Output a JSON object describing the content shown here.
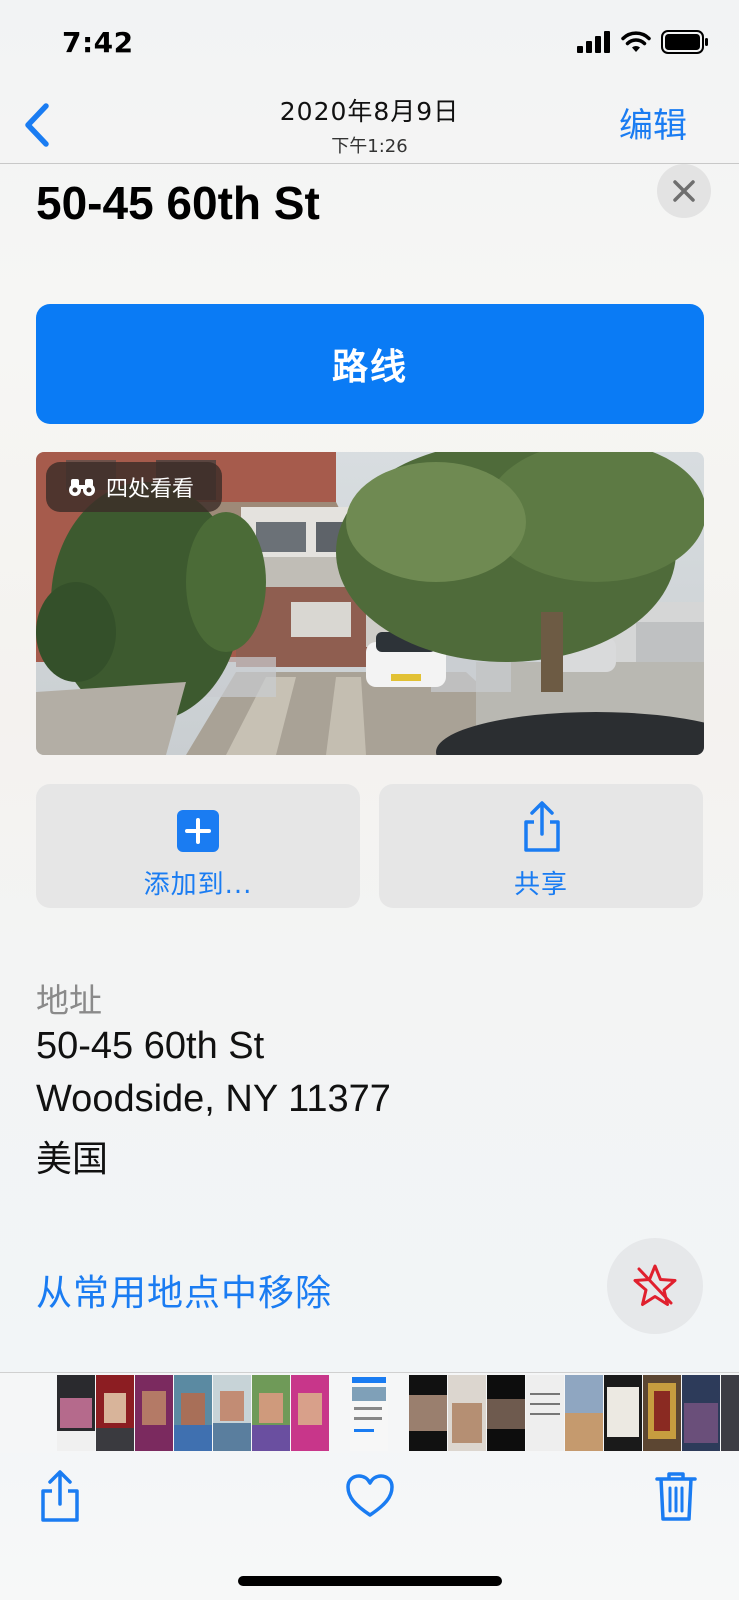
{
  "status_bar": {
    "time": "7:42"
  },
  "nav": {
    "date": "2020年8月9日",
    "time": "下午1:26",
    "edit_label": "编辑"
  },
  "place": {
    "title": "50-45 60th St"
  },
  "directions_label": "路线",
  "lookaround_label": "四处看看",
  "actions": {
    "add_label": "添加到...",
    "share_label": "共享"
  },
  "address": {
    "label": "地址",
    "line1": "50-45 60th St",
    "line2": "Woodside, NY  11377",
    "line3": "美国"
  },
  "remove_favorite_label": "从常用地点中移除",
  "colors": {
    "accent": "#0a7bf5",
    "link": "#1a7cf2",
    "star": "#e0202e"
  },
  "icons": [
    "back-chevron-icon",
    "close-icon",
    "binoculars-icon",
    "plus-square-icon",
    "share-icon",
    "star-slash-icon",
    "heart-icon",
    "trash-icon"
  ]
}
